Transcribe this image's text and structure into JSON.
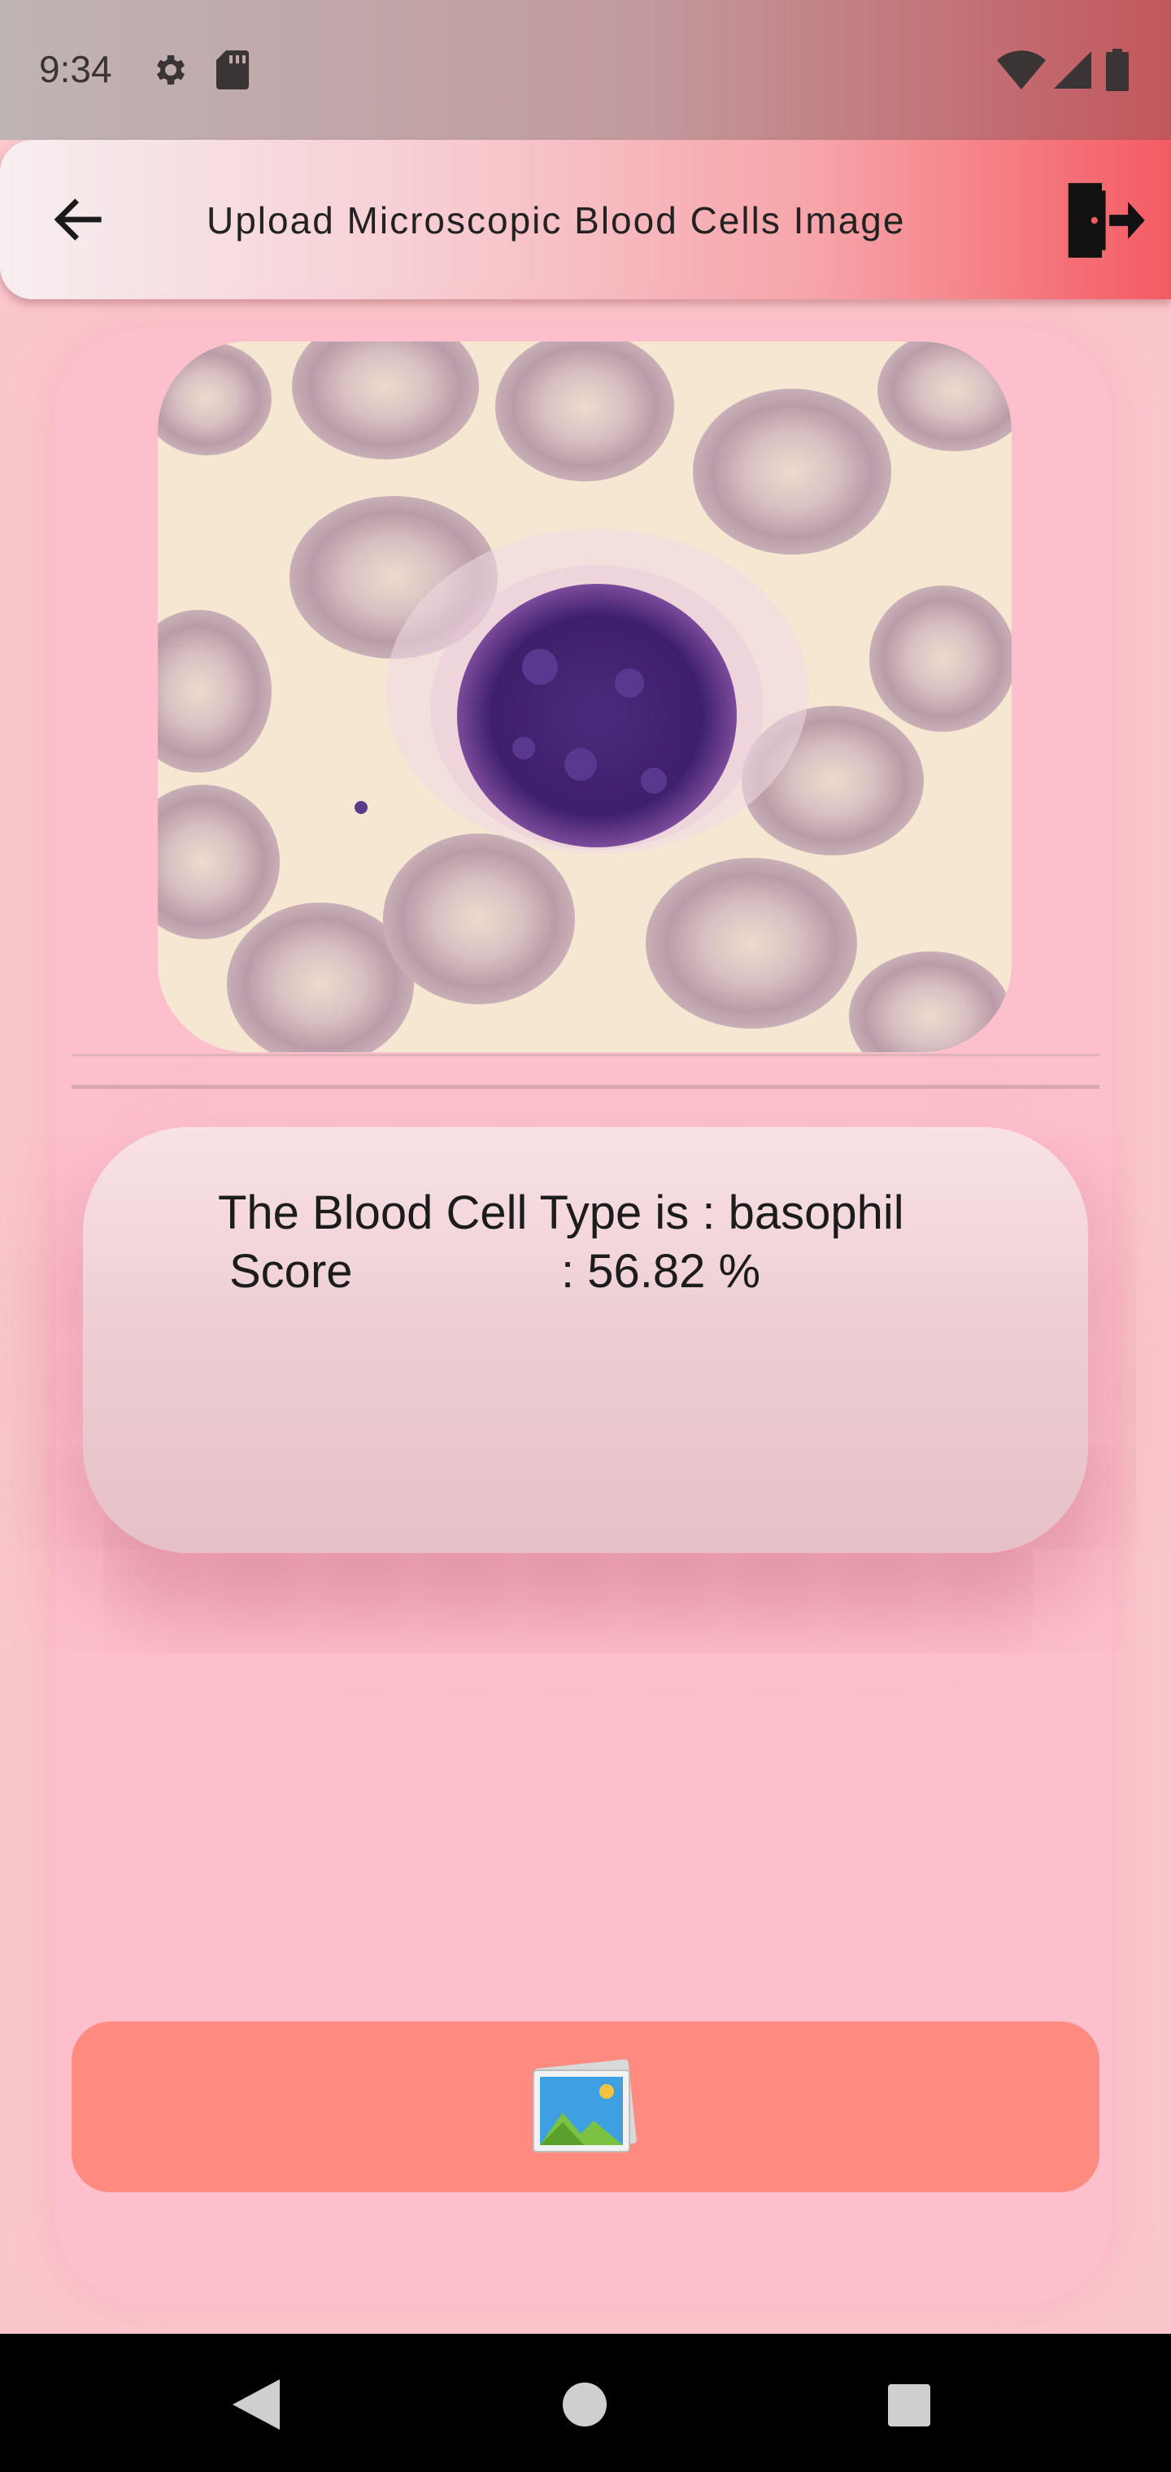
{
  "status_bar": {
    "time": "9:34",
    "icons": [
      "gear-icon",
      "sd-card-icon",
      "wifi-icon",
      "signal-icon",
      "battery-icon"
    ]
  },
  "app_bar": {
    "title": "Upload Microscopic Blood Cells Image",
    "back_icon": "arrow-left-icon",
    "logout_icon": "logout-icon",
    "gradient_end_color": "#f45b62"
  },
  "image_preview": {
    "icon": "blood-cell-image"
  },
  "result": {
    "type_line": "The Blood Cell Type is : basophil",
    "score_label": "Score",
    "score_value": ": 56.82 %"
  },
  "pick_button": {
    "icon": "gallery-icon",
    "color": "#fe8b80"
  },
  "nav_bar": {
    "icons": [
      "nav-back-icon",
      "nav-home-icon",
      "nav-recents-icon"
    ]
  }
}
